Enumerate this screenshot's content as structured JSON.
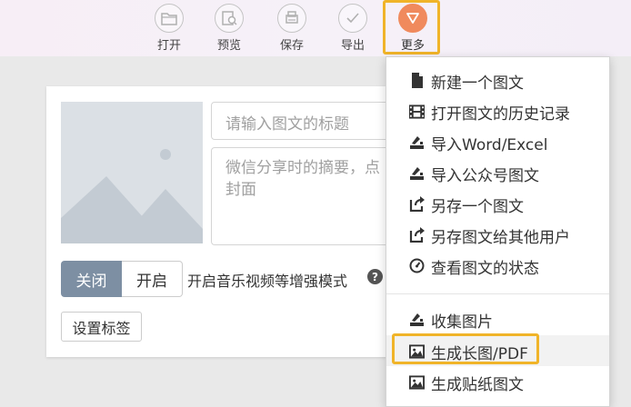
{
  "toolbar": {
    "buttons": [
      {
        "label": "打开",
        "icon": "folder-icon"
      },
      {
        "label": "预览",
        "icon": "preview-icon"
      },
      {
        "label": "保存",
        "icon": "save-icon"
      },
      {
        "label": "导出",
        "icon": "export-icon"
      },
      {
        "label": "更多",
        "icon": "triangle-down-icon",
        "active": true
      }
    ],
    "accent": "#f08a5d",
    "highlight": "#f0b429"
  },
  "editor": {
    "title_placeholder": "请输入图文的标题",
    "summary_placeholder": "微信分享时的摘要，点\n封面",
    "toggle": {
      "off_label": "关闭",
      "on_label": "开启",
      "selected": "关闭"
    },
    "mode_label": "开启音乐视频等增强模式",
    "help_symbol": "?",
    "tag_button": "设置标签"
  },
  "menu": {
    "items": [
      {
        "label": "新建一个图文",
        "icon": "file-icon"
      },
      {
        "label": "打开图文的历史记录",
        "icon": "film-icon"
      },
      {
        "label": "导入Word/Excel",
        "icon": "import-icon"
      },
      {
        "label": "导入公众号图文",
        "icon": "import-icon"
      },
      {
        "label": "另存一个图文",
        "icon": "share-icon"
      },
      {
        "label": "另存图文给其他用户",
        "icon": "share-icon"
      },
      {
        "label": "查看图文的状态",
        "icon": "gauge-icon"
      },
      {
        "label": "收集图片",
        "icon": "download-icon"
      },
      {
        "label": "生成长图/PDF",
        "icon": "image-icon",
        "highlighted": true
      },
      {
        "label": "生成贴纸图文",
        "icon": "image-icon"
      }
    ]
  }
}
